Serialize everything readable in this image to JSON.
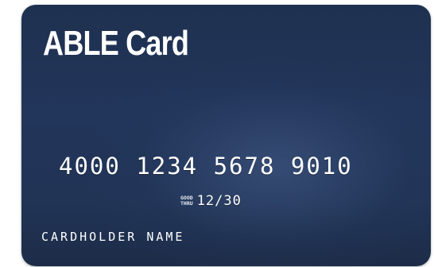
{
  "card": {
    "title": "ABLE Card",
    "number": "4000 1234 5678 9010",
    "good_thru_line1": "GOOD",
    "good_thru_line2": "THRU",
    "expiry": "12/30",
    "cardholder": "CARDHOLDER NAME",
    "colors": {
      "card_base": "#213456",
      "text": "#ffffff"
    }
  }
}
